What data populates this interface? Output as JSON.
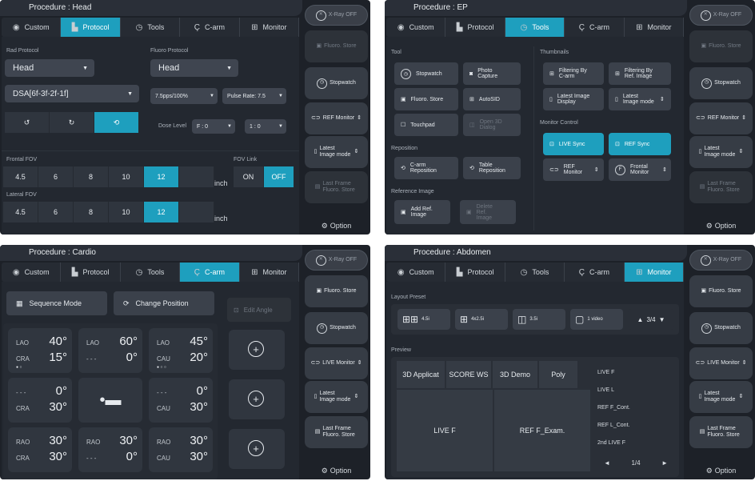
{
  "tabs": {
    "custom": "Custom",
    "protocol": "Protocol",
    "tools": "Tools",
    "carm": "C-arm",
    "monitor": "Monitor"
  },
  "side": {
    "xray_off": "X-Ray OFF",
    "fluoro_store": "Fluoro. Store",
    "stopwatch": "Stopwatch",
    "ref_monitor": "REF Monitor",
    "live_monitor": "LIVE Monitor",
    "latest_image_mode": "Latest Image mode",
    "last_frame": "Last Frame Fluoro. Store",
    "option": "Option"
  },
  "q1": {
    "title": "Procedure : Head",
    "rad_protocol": "Rad Protocol",
    "rad_value": "Head",
    "dsa_value": "DSA[6f-3f-2f-1f]",
    "fluoro_protocol": "Fluoro Protocol",
    "fluoro_value": "Head",
    "pps_value": "7.5pps/100%",
    "pulse_rate": "Pulse Rate: 7.5",
    "dose_level": "Dose Level",
    "dose_f": "F : 0",
    "dose_ratio": "1 : 0",
    "frontal_fov": "Frontal FOV",
    "lateral_fov": "Lateral FOV",
    "fov_values": [
      "4.5",
      "6",
      "8",
      "10",
      "12"
    ],
    "fov_selected": "12",
    "unit": "inch",
    "fov_link": "FOV Link",
    "on": "ON",
    "off": "OFF"
  },
  "q2": {
    "title": "Procedure : EP",
    "tool": "Tool",
    "stopwatch": "Stopwatch",
    "photo_capture": "Photo Capture",
    "fluoro_store": "Fluoro. Store",
    "autosid": "AutoSID",
    "touchpad": "Touchpad",
    "open_3d": "Open 3D Dialog",
    "reposition": "Reposition",
    "carm_reposition": "C-arm Reposition",
    "table_reposition": "Table Reposition",
    "reference_image": "Reference Image",
    "add_ref": "Add Ref. Image",
    "delete_ref": "Delete Ref. Image",
    "thumbnails": "Thumbnails",
    "filter_carm": "Filtering By C-arm",
    "filter_ref": "Filtering By Ref. Image",
    "latest_display": "Latest Image Display",
    "latest_mode": "Latest Image mode",
    "monitor_control": "Monitor Control",
    "live_sync": "LIVE Sync",
    "ref_sync": "REF Sync",
    "ref_monitor": "REF Monitor",
    "frontal_monitor": "Frontal Monitor"
  },
  "q3": {
    "title": "Procedure : Cardio",
    "sequence_mode": "Sequence Mode",
    "change_position": "Change Position",
    "edit_angle": "Edit Angle",
    "cards": [
      {
        "r1k": "LAO",
        "r1v": "40°",
        "r2k": "CRA",
        "r2v": "15°"
      },
      {
        "r1k": "LAO",
        "r1v": "60°",
        "r2k": "- - -",
        "r2v": "0°"
      },
      {
        "r1k": "LAO",
        "r1v": "45°",
        "r2k": "CAU",
        "r2v": "20°"
      },
      {
        "r1k": "- - -",
        "r1v": "0°",
        "r2k": "CRA",
        "r2v": "30°"
      },
      {
        "r1k": "- - -",
        "r1v": "0°",
        "r2k": "CAU",
        "r2v": "30°"
      },
      {
        "r1k": "RAO",
        "r1v": "30°",
        "r2k": "CRA",
        "r2v": "30°"
      },
      {
        "r1k": "RAO",
        "r1v": "30°",
        "r2k": "- - -",
        "r2v": "0°"
      },
      {
        "r1k": "RAO",
        "r1v": "30°",
        "r2k": "CAU",
        "r2v": "30°"
      }
    ]
  },
  "q4": {
    "title": "Procedure : Abdomen",
    "layout_preset": "Layout Preset",
    "presets": [
      "4.5i",
      "4x2.5i",
      "3.5i",
      "1 video"
    ],
    "preset_page": "3/4",
    "preview": "Preview",
    "top_cells": [
      "3D Applicat",
      "SCORE WS",
      "3D Demo",
      "Poly"
    ],
    "live_f": "LIVE F",
    "ref_f_exam": "REF F_Exam.",
    "list": [
      "LIVE F",
      "LIVE L",
      "REF F_Cont.",
      "REF L_Cont.",
      "2nd LIVE F"
    ],
    "list_page": "1/4"
  }
}
